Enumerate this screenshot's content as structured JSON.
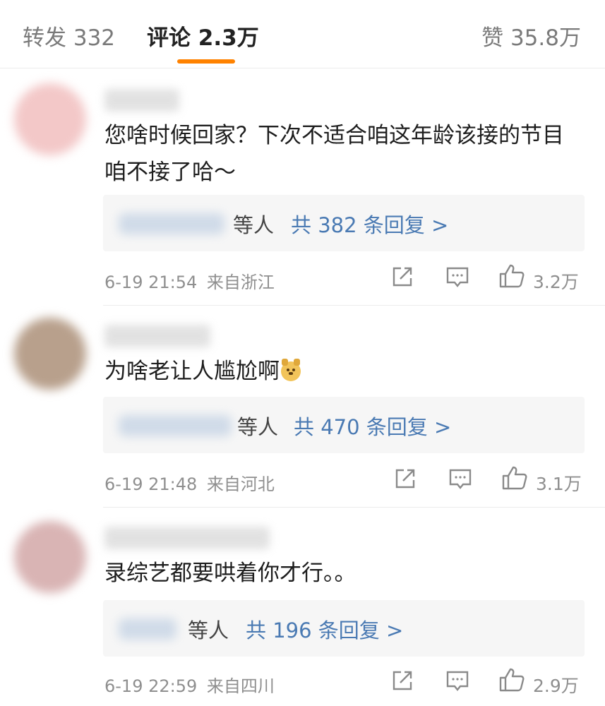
{
  "tabs": {
    "repost": "转发 332",
    "comments": "评论 2.3万",
    "likes": "赞 35.8万"
  },
  "comments": [
    {
      "text": "您啥时候回家？下次不适合咱这年龄该接的节目咱不接了哈～",
      "reply_who": "等人",
      "reply_link": "共 382 条回复 >",
      "time": "6-19 21:54",
      "location": "来自浙江",
      "likes": "3.2万",
      "avatar_color": "#f3c8c8"
    },
    {
      "text": "为啥老让人尴尬啊",
      "emoji": "doge-emoji",
      "reply_who": "等人",
      "reply_link": "共 470 条回复 >",
      "time": "6-19 21:48",
      "location": "来自河北",
      "likes": "3.1万",
      "avatar_color": "#b8a08c"
    },
    {
      "text": "录综艺都要哄着你才行。。",
      "reply_who": "等人",
      "reply_link": "共 196 条回复 >",
      "time": "6-19 22:59",
      "location": "来自四川",
      "likes": "2.9万",
      "avatar_color": "#d9b4b4"
    }
  ],
  "icons": {
    "share": "share-icon",
    "comment": "comment-icon",
    "like": "thumbs-up-icon"
  }
}
